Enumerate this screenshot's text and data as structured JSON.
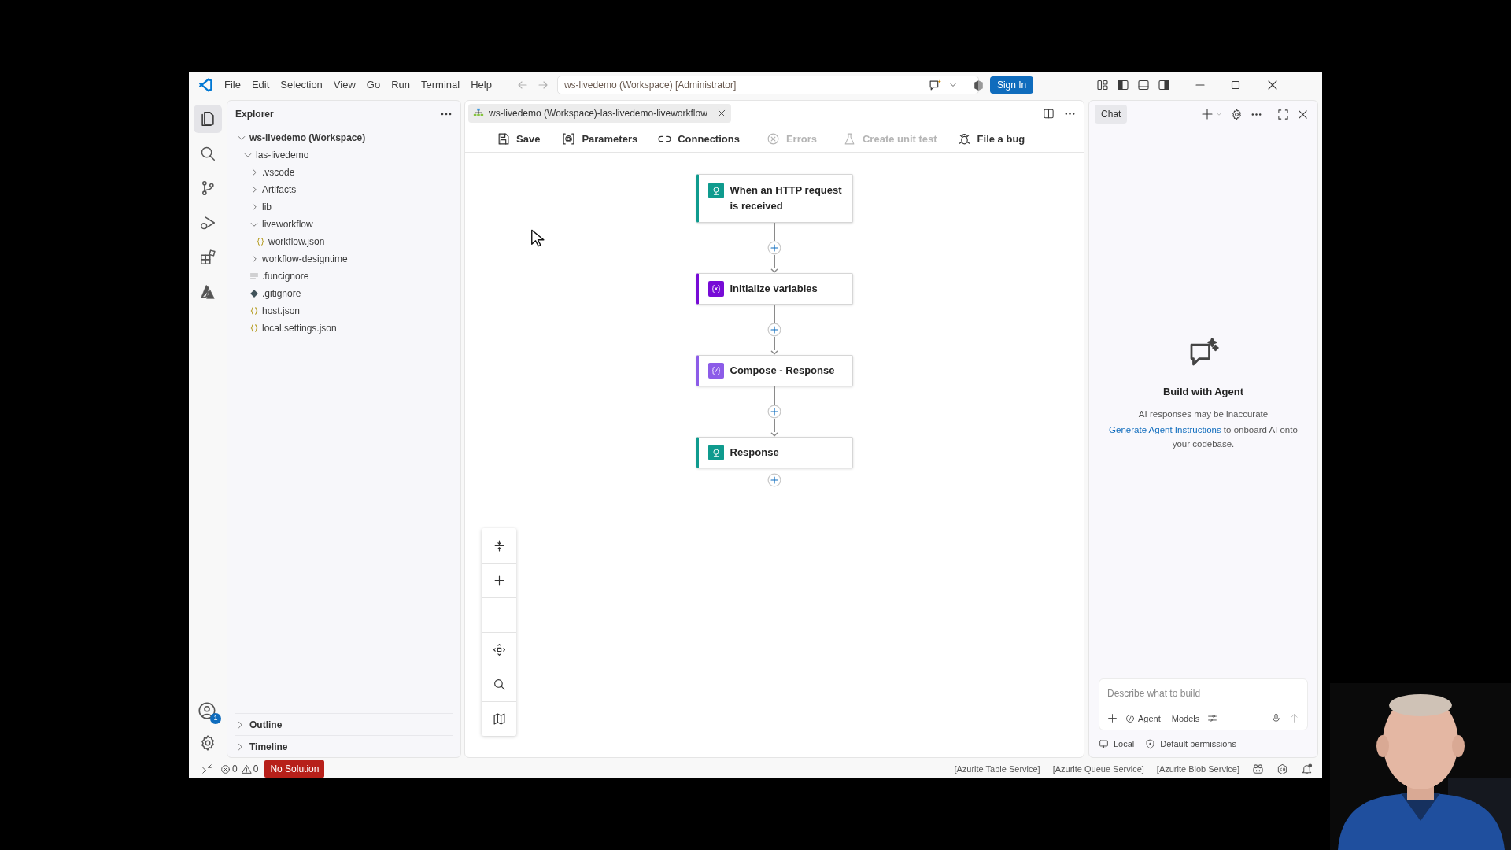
{
  "menu": [
    "File",
    "Edit",
    "Selection",
    "View",
    "Go",
    "Run",
    "Terminal",
    "Help"
  ],
  "command_center": "ws-livedemo (Workspace) [Administrator]",
  "sign_in": "Sign In",
  "accounts_badge": "1",
  "explorer": {
    "title": "Explorer",
    "tree": [
      {
        "label": "ws-livedemo (Workspace)",
        "kind": "root",
        "expanded": true,
        "children": [
          {
            "label": "las-livedemo",
            "kind": "folder",
            "expanded": true,
            "children": [
              {
                "label": ".vscode",
                "kind": "folder",
                "expanded": false
              },
              {
                "label": "Artifacts",
                "kind": "folder",
                "expanded": false
              },
              {
                "label": "lib",
                "kind": "folder",
                "expanded": false
              },
              {
                "label": "liveworkflow",
                "kind": "folder",
                "expanded": true,
                "children": [
                  {
                    "label": "workflow.json",
                    "kind": "json"
                  }
                ]
              },
              {
                "label": "workflow-designtime",
                "kind": "folder",
                "expanded": false
              },
              {
                "label": ".funcignore",
                "kind": "text"
              },
              {
                "label": ".gitignore",
                "kind": "git"
              },
              {
                "label": "host.json",
                "kind": "json"
              },
              {
                "label": "local.settings.json",
                "kind": "json"
              }
            ]
          }
        ]
      }
    ],
    "sections": [
      {
        "label": "Outline",
        "expanded": false
      },
      {
        "label": "Timeline",
        "expanded": false
      }
    ]
  },
  "editor": {
    "tab": "ws-livedemo (Workspace)-las-livedemo-liveworkflow",
    "toolbar": [
      {
        "label": "Save",
        "kind": "save",
        "disabled": false
      },
      {
        "label": "Parameters",
        "kind": "parameters",
        "disabled": false
      },
      {
        "label": "Connections",
        "kind": "connections",
        "disabled": false
      },
      {
        "label": "Errors",
        "kind": "errors",
        "disabled": true
      },
      {
        "label": "Create unit test",
        "kind": "test",
        "disabled": true
      },
      {
        "label": "File a bug",
        "kind": "bug",
        "disabled": false
      }
    ],
    "nodes": [
      {
        "title": "When an HTTP request is received",
        "kind": "trigger",
        "color": "#0f9b8e"
      },
      {
        "title": "Initialize variables",
        "kind": "variables",
        "color": "#770bd6"
      },
      {
        "title": "Compose - Response",
        "kind": "compose",
        "color": "#8c5ce8"
      },
      {
        "title": "Response",
        "kind": "response",
        "color": "#0f9b8e"
      }
    ]
  },
  "chat": {
    "tab": "Chat",
    "heading": "Build with Agent",
    "notice": "AI responses may be inaccurate",
    "link": "Generate Agent Instructions",
    "after_link": "to onboard AI onto your codebase.",
    "placeholder": "Describe what to build",
    "mode": "Agent",
    "models": "Models",
    "location": "Local",
    "permissions": "Default permissions"
  },
  "status_bar": {
    "errors": "0",
    "warnings": "0",
    "solution": "No Solution",
    "items": [
      "[Azurite Table Service]",
      "[Azurite Queue Service]",
      "[Azurite Blob Service]"
    ]
  }
}
